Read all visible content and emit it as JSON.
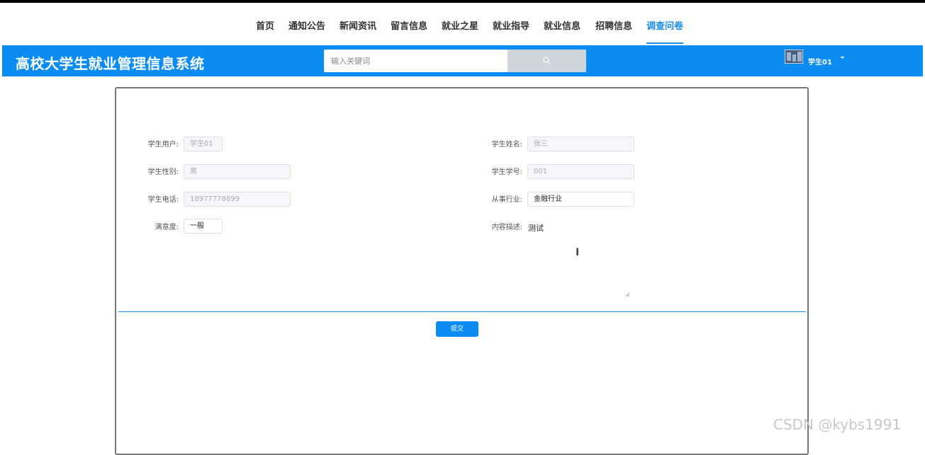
{
  "nav": {
    "items": [
      {
        "label": "首页"
      },
      {
        "label": "通知公告"
      },
      {
        "label": "新闻资讯"
      },
      {
        "label": "留言信息"
      },
      {
        "label": "就业之星"
      },
      {
        "label": "就业指导"
      },
      {
        "label": "就业信息"
      },
      {
        "label": "招聘信息"
      },
      {
        "label": "调查问卷"
      }
    ],
    "active_label": "调查问卷"
  },
  "header": {
    "site_title": "高校大学生就业管理信息系统",
    "search_placeholder": "输入关键词",
    "user_name": "学生01",
    "accent_color": "#0a8cf2"
  },
  "form": {
    "student_account": {
      "label": "学生用户:",
      "value": "学生01"
    },
    "student_name": {
      "label": "学生姓名:",
      "value": "张三"
    },
    "gender": {
      "label": "学生性别:",
      "value": "男"
    },
    "student_id": {
      "label": "学生学号:",
      "value": "001"
    },
    "phone": {
      "label": "学生电话:",
      "value": "18977778899"
    },
    "industry": {
      "label": "从事行业:",
      "value": "金融行业"
    },
    "satisfaction": {
      "label": "满意度:",
      "value": "一般"
    },
    "description": {
      "label": "内容描述:",
      "value": "测试"
    },
    "submit_label": "提交"
  },
  "watermark": "CSDN @kybs1991",
  "icons": [
    "search-icon",
    "avatar",
    "caret-down-icon",
    "resize-grip-icon",
    "text-cursor-icon"
  ]
}
